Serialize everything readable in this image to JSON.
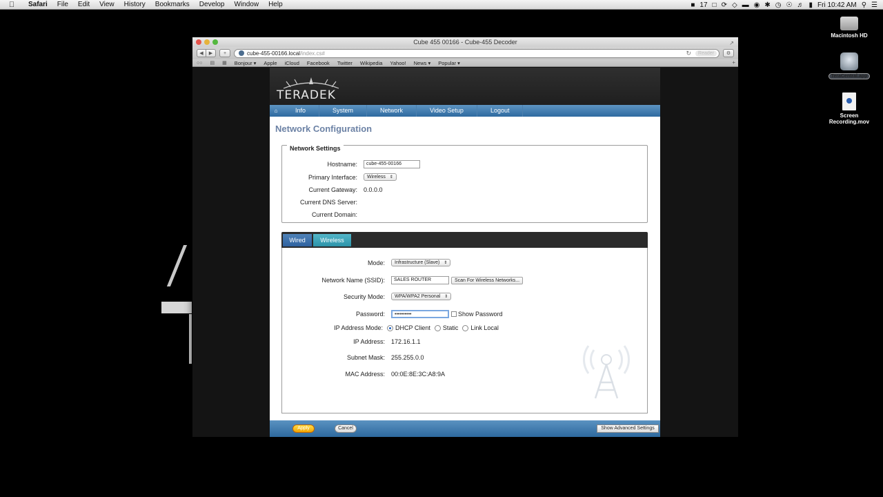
{
  "menubar": {
    "apple": "",
    "items": [
      "Safari",
      "File",
      "Edit",
      "View",
      "History",
      "Bookmarks",
      "Develop",
      "Window",
      "Help"
    ],
    "status": {
      "battery_label": "17",
      "clock": "Fri 10:42 AM"
    }
  },
  "desktop": {
    "icons": [
      {
        "label": "Macintosh HD",
        "icon": "hard-drive-icon"
      },
      {
        "label": "TeraCentral.app",
        "icon": "app-icon"
      },
      {
        "label_line1": "Screen",
        "label_line2": "Recording.mov",
        "icon": "movie-file-icon"
      }
    ]
  },
  "browser": {
    "window_title": "Cube 455 00166 - Cube-455 Decoder",
    "url_host": "cube-455-00166.local",
    "url_path": "/index.cs#",
    "reader_label": "Reader",
    "bookmarks": [
      "Bonjour ▾",
      "Apple",
      "iCloud",
      "Facebook",
      "Twitter",
      "Wikipedia",
      "Yahoo!",
      "News ▾",
      "Popular ▾"
    ]
  },
  "page": {
    "brand": "TERADEK",
    "nav": [
      "Info",
      "System",
      "Network",
      "Video Setup",
      "Logout"
    ],
    "title": "Network Configuration",
    "network_settings": {
      "legend": "Network Settings",
      "hostname_label": "Hostname:",
      "hostname_value": "cube-455-00166",
      "primary_interface_label": "Primary Interface:",
      "primary_interface_value": "Wireless",
      "gateway_label": "Current Gateway:",
      "gateway_value": "0.0.0.0",
      "dns_label": "Current DNS Server:",
      "domain_label": "Current Domain:"
    },
    "tabs": {
      "wired": "Wired",
      "wireless": "Wireless"
    },
    "wireless": {
      "mode_label": "Mode:",
      "mode_value": "Infrastructure (Slave)",
      "ssid_label": "Network Name (SSID):",
      "ssid_value": "SALES ROUTER",
      "scan_button": "Scan For Wireless Networks...",
      "security_label": "Security Mode:",
      "security_value": "WPA/WPA2 Personal",
      "password_label": "Password:",
      "password_value": "••••••••••",
      "show_password": "Show Password",
      "ip_mode_label": "IP Address Mode:",
      "ip_mode_options": [
        "DHCP Client",
        "Static",
        "Link Local"
      ],
      "ip_label": "IP Address:",
      "ip_value": "172.16.1.1",
      "subnet_label": "Subnet Mask:",
      "subnet_value": "255.255.0.0",
      "mac_label": "MAC Address:",
      "mac_value": "00:0E:8E:3C:A8:9A"
    },
    "footer": {
      "apply": "Apply",
      "cancel": "Cancel",
      "advanced": "Show Advanced Settings"
    }
  }
}
